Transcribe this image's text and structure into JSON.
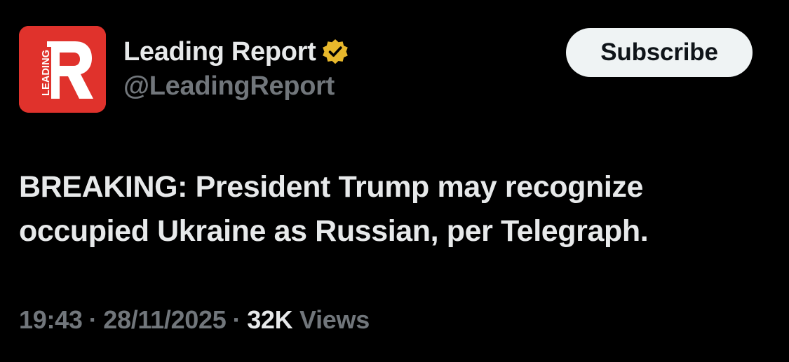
{
  "account": {
    "display_name": "Leading Report",
    "handle": "@LeadingReport",
    "avatar_letter": "R",
    "avatar_text": "LEADING",
    "avatar_color": "#e0322c",
    "verified_badge_color": "#e8b82c",
    "verified_icon": "verified-badge-icon"
  },
  "subscribe_label": "Subscribe",
  "tweet": {
    "text": "BREAKING: President Trump may recognize occupied Ukraine as Russian, per Telegraph."
  },
  "meta": {
    "time": "19:43",
    "separator": "·",
    "date": "28/11/2025",
    "views_count": "32K",
    "views_label": "Views"
  }
}
